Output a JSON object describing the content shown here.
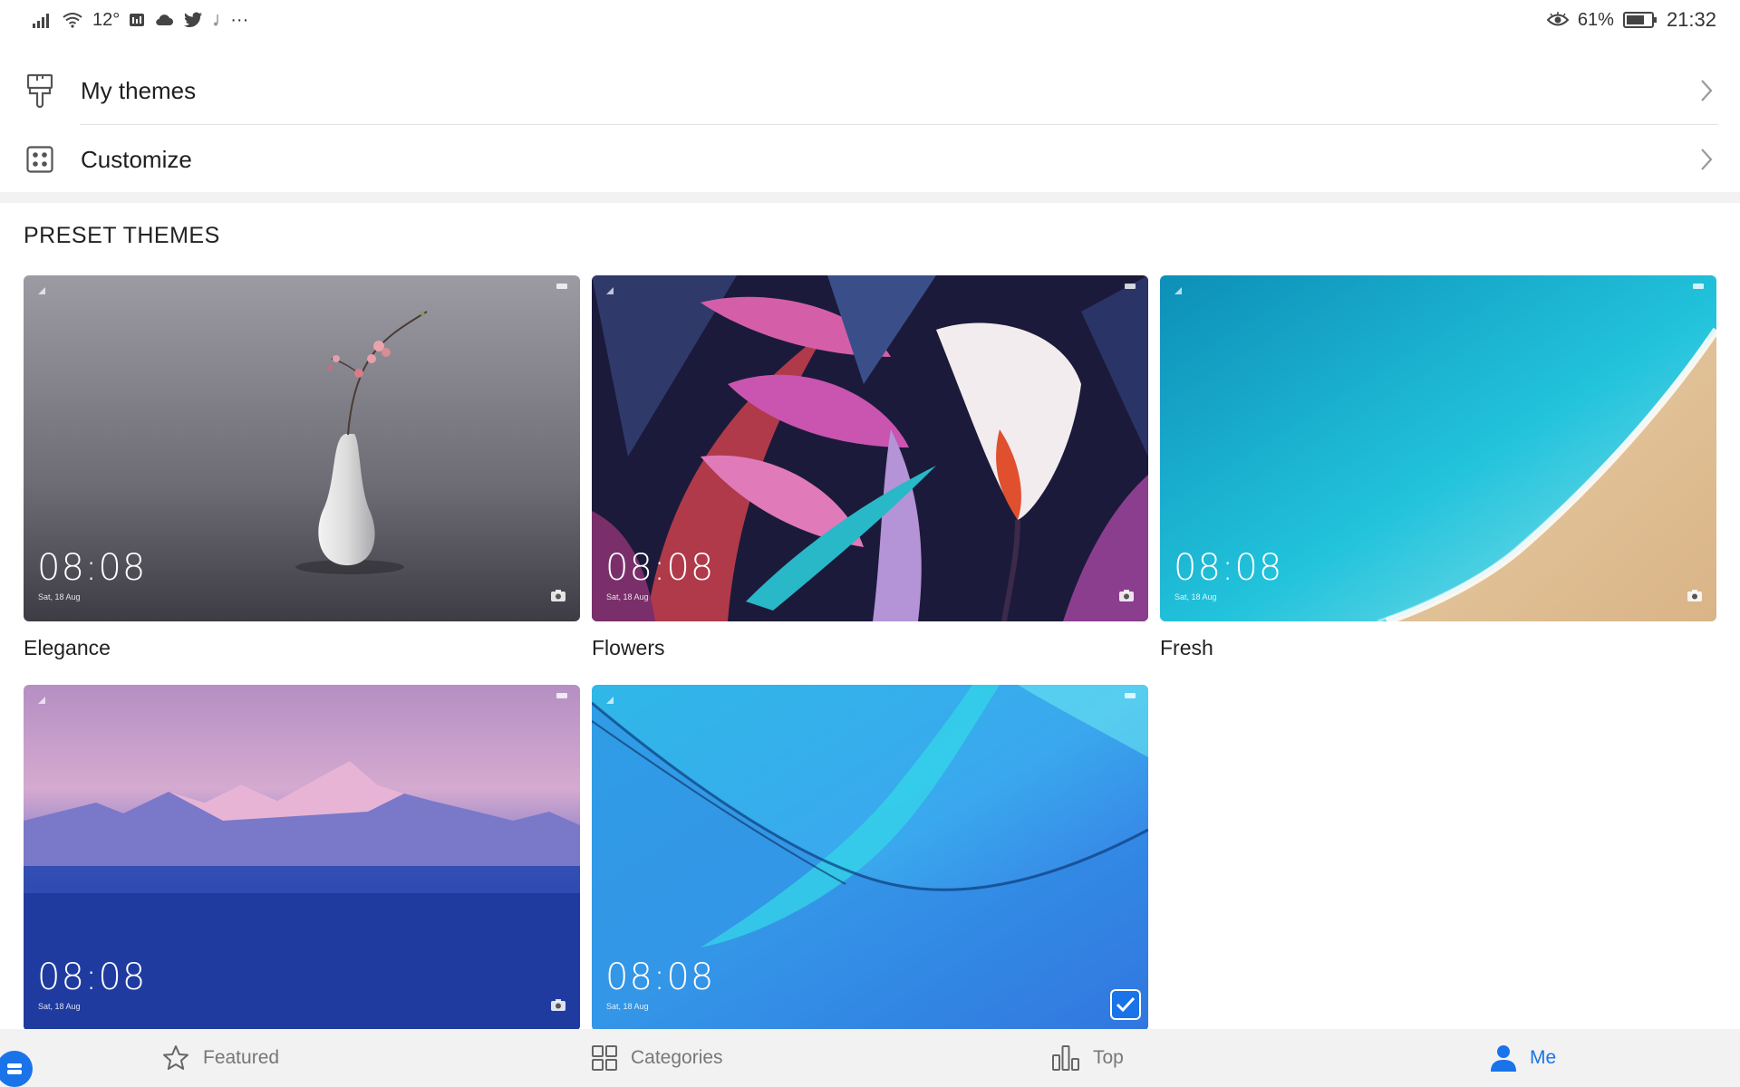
{
  "status_bar": {
    "temperature": "12°",
    "battery_percent": "61%",
    "time": "21:32",
    "more": "···"
  },
  "menu": {
    "items": [
      {
        "label": "My themes",
        "icon": "paintbrush-icon"
      },
      {
        "label": "Customize",
        "icon": "grid-dots-icon"
      }
    ]
  },
  "section": {
    "title": "PRESET THEMES"
  },
  "themes": [
    {
      "name": "Elegance",
      "time": "08:08",
      "date": "Sat, 18 Aug",
      "selected": false
    },
    {
      "name": "Flowers",
      "time": "08:08",
      "date": "Sat, 18 Aug",
      "selected": false
    },
    {
      "name": "Fresh",
      "time": "08:08",
      "date": "Sat, 18 Aug",
      "selected": false
    },
    {
      "name": "",
      "time": "08:08",
      "date": "Sat, 18 Aug",
      "selected": false
    },
    {
      "name": "",
      "time": "08:08",
      "date": "Sat, 18 Aug",
      "selected": true
    }
  ],
  "bottom_nav": {
    "items": [
      {
        "label": "Featured",
        "icon": "star-icon",
        "active": false
      },
      {
        "label": "Categories",
        "icon": "categories-icon",
        "active": false
      },
      {
        "label": "Top",
        "icon": "bar-chart-icon",
        "active": false
      },
      {
        "label": "Me",
        "icon": "person-icon",
        "active": true
      }
    ]
  },
  "colors": {
    "accent": "#1a73e8",
    "nav_bg": "#f2f2f2"
  }
}
